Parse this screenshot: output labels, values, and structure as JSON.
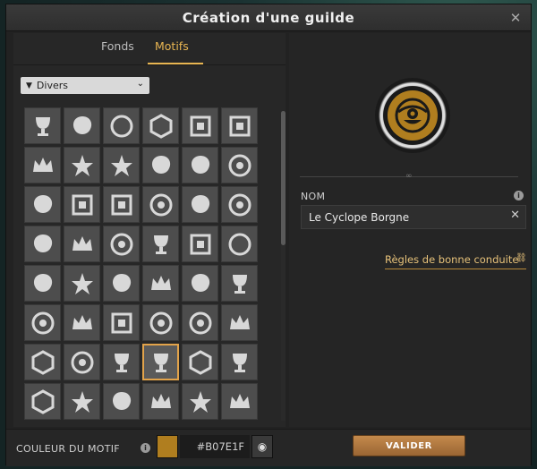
{
  "dialog": {
    "title": "Création d'une guilde",
    "close_label": "✕"
  },
  "tabs": [
    {
      "label": "Fonds",
      "active": false
    },
    {
      "label": "Motifs",
      "active": true
    }
  ],
  "filter": {
    "selected": "Divers"
  },
  "motifs": {
    "selected_index": 39,
    "rows": [
      [
        "balance",
        "swirl",
        "flower",
        "diamond",
        "knot-square",
        "knot-cross"
      ],
      [
        "fleur-de-lis",
        "snowflake",
        "compass-star",
        "triskelion",
        "triangle-swirl",
        "spiral"
      ],
      [
        "mushroom",
        "book",
        "padlock",
        "key",
        "crab",
        "gear-hand"
      ],
      [
        "boot",
        "crown-small",
        "ring",
        "torch",
        "cards",
        "wreath"
      ],
      [
        "figure",
        "crossed-hammers",
        "statue",
        "crown",
        "feathers",
        "potion"
      ],
      [
        "cane",
        "candelabra",
        "scroll",
        "cyclops",
        "eye",
        "castle"
      ],
      [
        "honeycomb",
        "crosshair",
        "hourglass",
        "trophy",
        "hexagon",
        "chalice"
      ],
      [
        "hex-nut",
        "compass",
        "horn",
        "ship",
        "ship-wheel",
        "crown-ornate"
      ]
    ]
  },
  "preview": {
    "emblem_icon": "cyclops",
    "motif_color": "#B07E1F"
  },
  "name": {
    "label": "NOM",
    "value": "Le Cyclope Borgne",
    "info_icon": "info-icon",
    "clear_label": "✕"
  },
  "rules": {
    "label": "Règles de bonne conduite"
  },
  "color": {
    "label": "COULEUR DU MOTIF",
    "hex": "#B07E1F",
    "swatch": "#B07E1F"
  },
  "actions": {
    "validate_label": "VALIDER"
  }
}
